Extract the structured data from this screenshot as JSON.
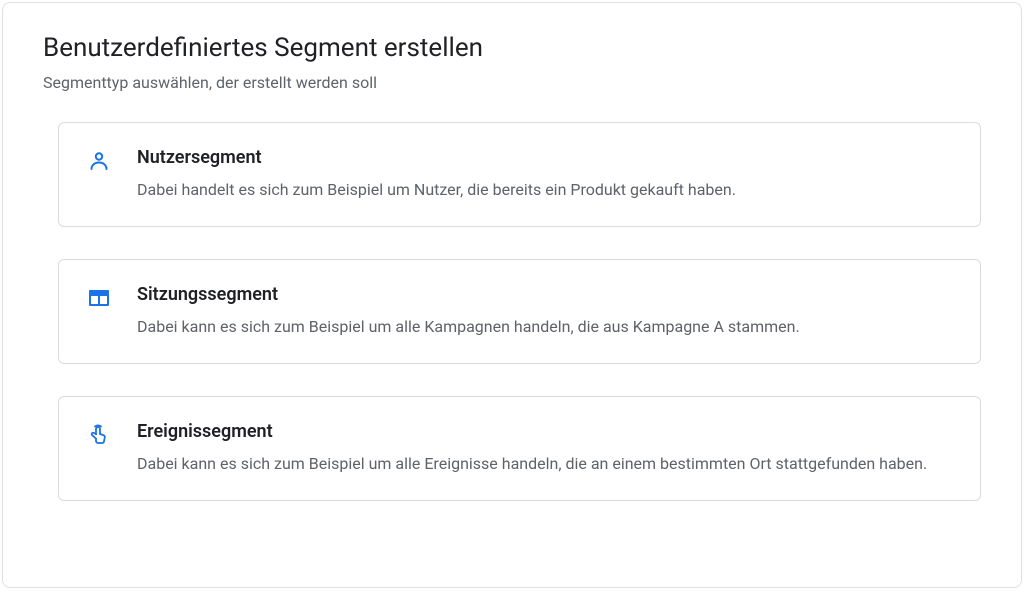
{
  "header": {
    "title": "Benutzerdefiniertes Segment erstellen",
    "subtitle": "Segmenttyp auswählen, der erstellt werden soll"
  },
  "segments": [
    {
      "icon": "person-icon",
      "title": "Nutzersegment",
      "description": "Dabei handelt es sich zum Beispiel um Nutzer, die bereits ein Produkt gekauft haben."
    },
    {
      "icon": "web-icon",
      "title": "Sitzungssegment",
      "description": "Dabei kann es sich zum Beispiel um alle Kampagnen handeln, die aus Kampagne A stammen."
    },
    {
      "icon": "touch-icon",
      "title": "Ereignissegment",
      "description": "Dabei kann es sich zum Beispiel um alle Ereignisse handeln, die an einem bestimmten Ort stattgefunden haben."
    }
  ],
  "colors": {
    "accent": "#1a73e8",
    "text_primary": "#202124",
    "text_secondary": "#5f6368",
    "border": "#dadce0"
  }
}
